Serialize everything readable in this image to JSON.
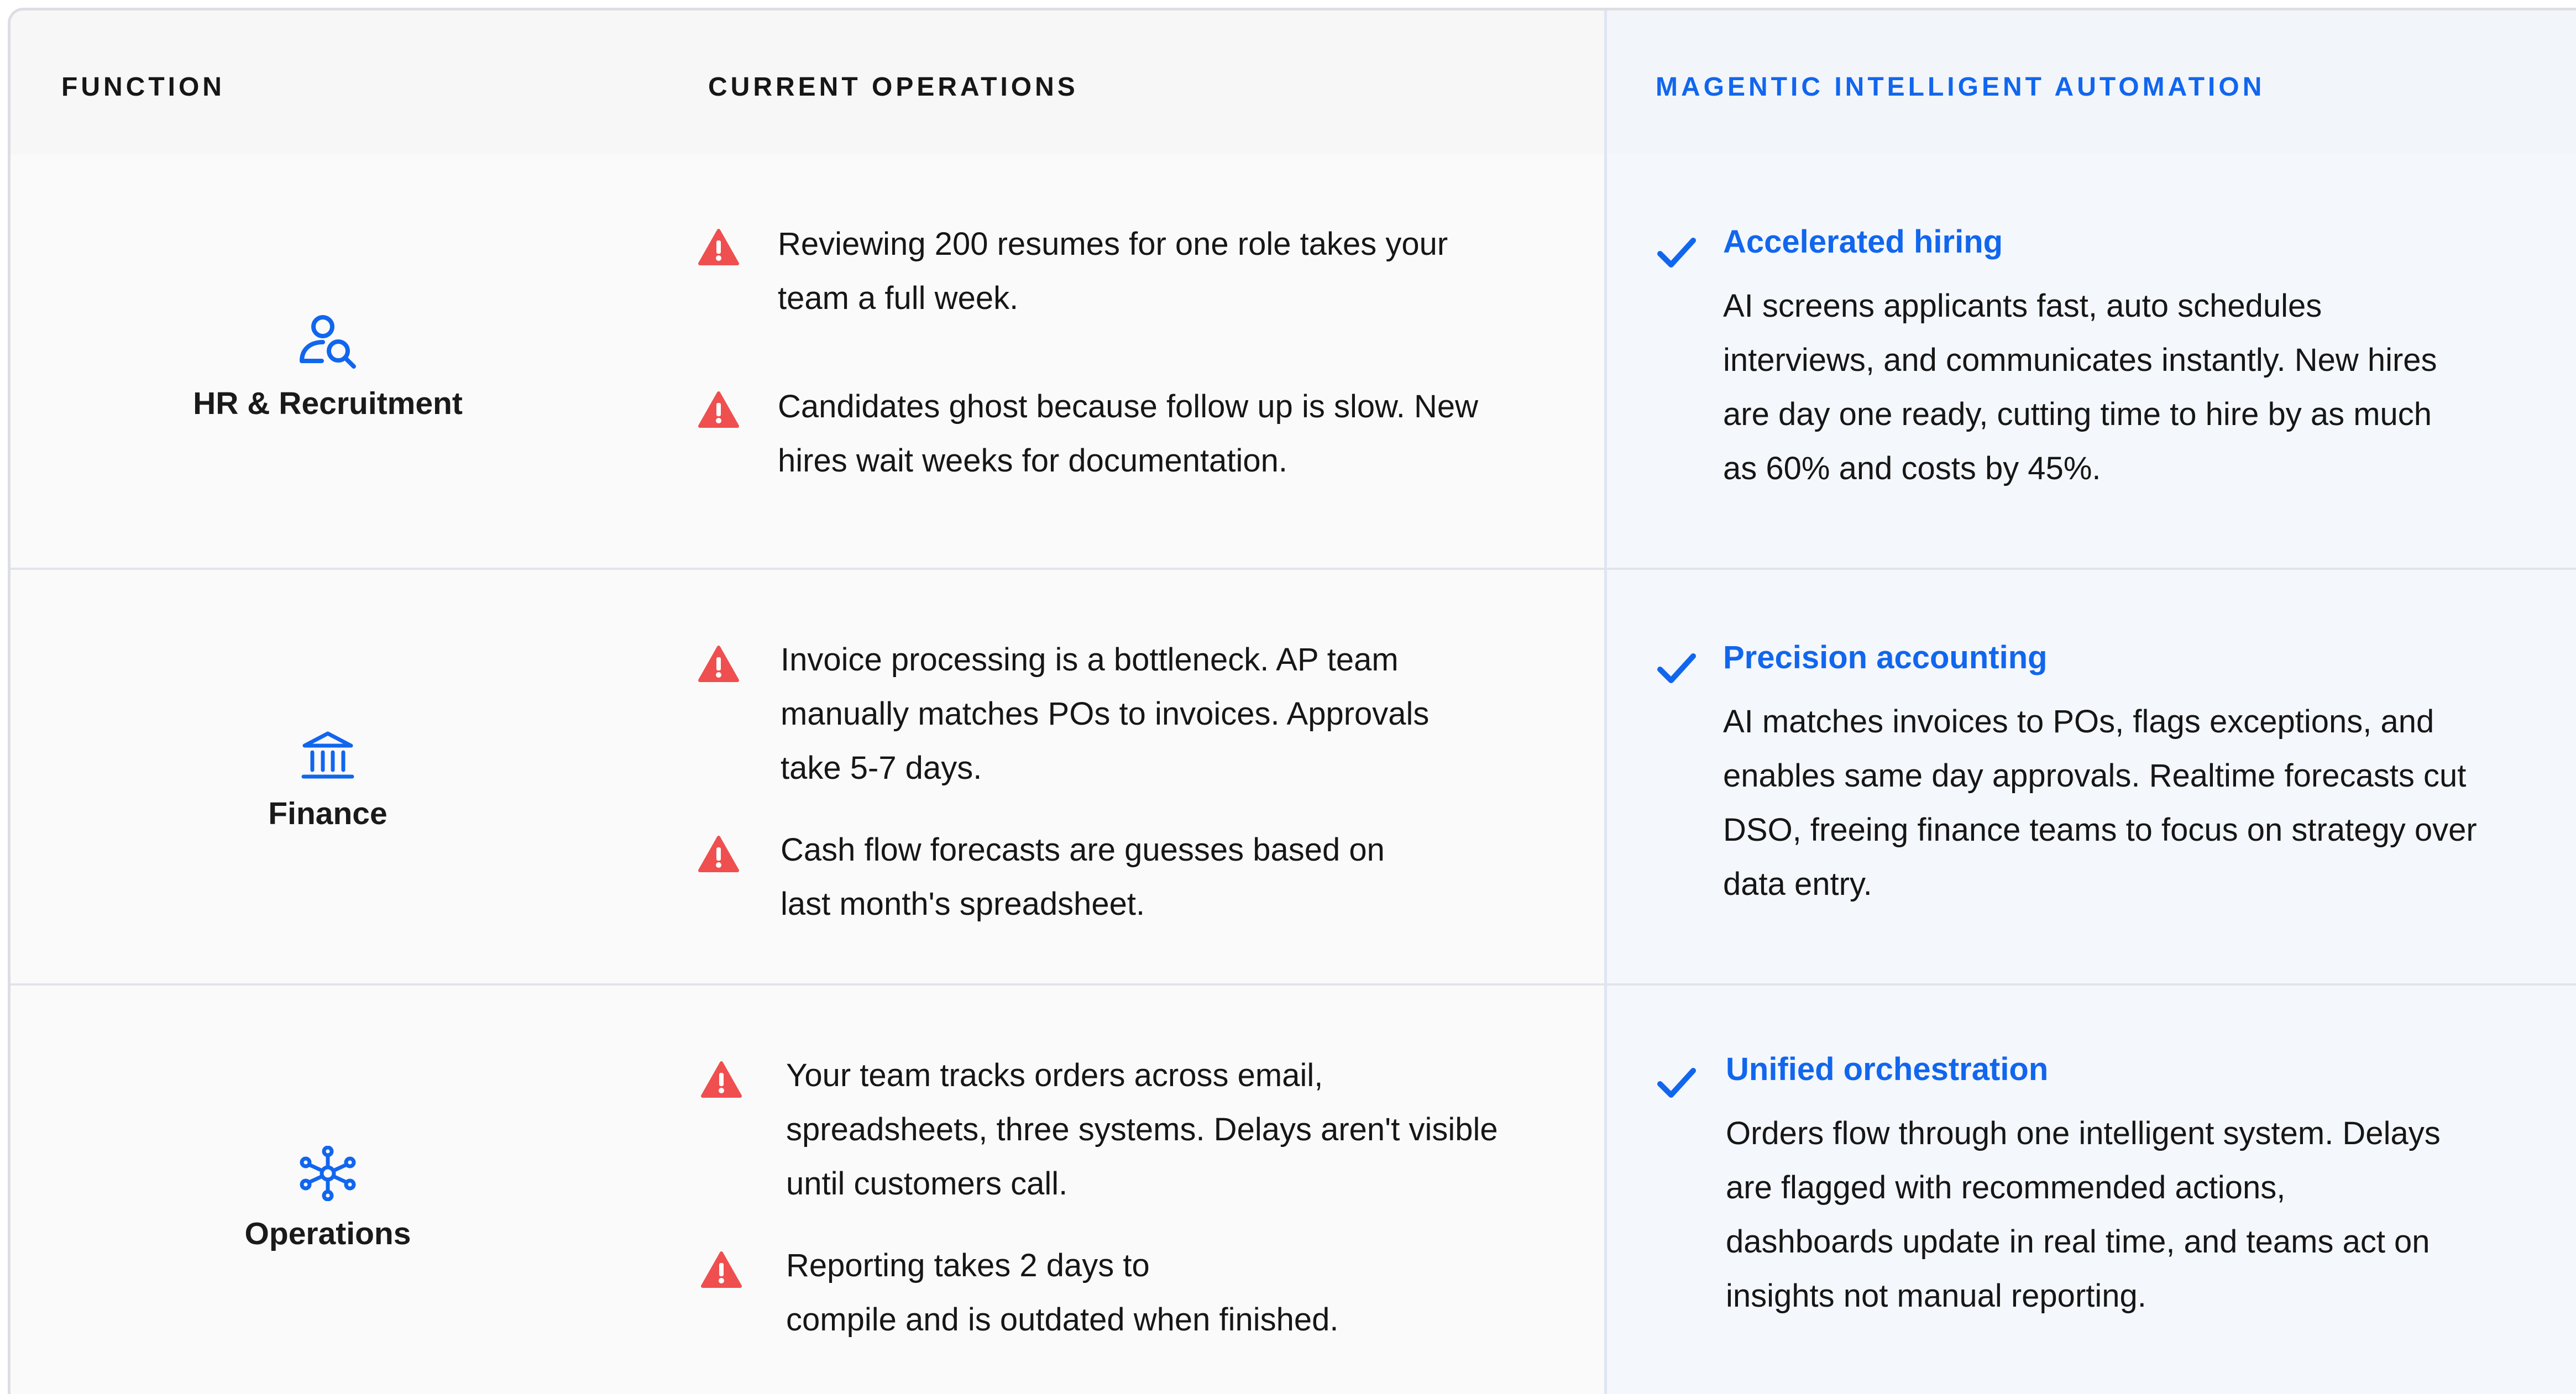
{
  "header": {
    "function": "FUNCTION",
    "current": "CURRENT OPERATIONS",
    "automation": "MAGENTIC INTELLIGENT AUTOMATION"
  },
  "colors": {
    "accent": "#1166ee",
    "warning": "#ef4f4f"
  },
  "rows": [
    {
      "function": "HR & Recruitment",
      "icon": "user-search-icon",
      "issues": [
        [
          "Reviewing 200 resumes for one role takes your",
          "team a full week."
        ],
        [
          "Candidates ghost because follow up is slow. New",
          "hires wait weeks for documentation."
        ]
      ],
      "solution_title": "Accelerated hiring",
      "solution_lines": [
        "AI screens applicants fast, auto schedules",
        "interviews, and communicates instantly. New hires",
        "are day one ready, cutting time to hire by as much",
        "as 60% and costs by 45%."
      ]
    },
    {
      "function": "Finance",
      "icon": "bank-icon",
      "issues": [
        [
          "Invoice processing is a bottleneck. AP team",
          "manually matches POs to invoices. Approvals",
          "take 5-7 days."
        ],
        [
          "Cash flow forecasts are guesses based on",
          "last month's spreadsheet."
        ]
      ],
      "solution_title": "Precision accounting",
      "solution_lines": [
        "AI matches invoices to POs, flags exceptions, and",
        "enables same day approvals. Realtime forecasts cut",
        "DSO, freeing finance teams to focus on strategy over",
        "data entry."
      ]
    },
    {
      "function": "Operations",
      "icon": "network-hub-icon",
      "issues": [
        [
          "Your team tracks orders across email,",
          "spreadsheets, three systems. Delays aren't visible",
          "until customers call."
        ],
        [
          "Reporting takes 2 days to",
          "compile and is outdated when finished."
        ]
      ],
      "solution_title": "Unified orchestration",
      "solution_lines": [
        "Orders flow through one intelligent system. Delays",
        "are flagged with recommended actions,",
        "dashboards update in real time, and teams act on",
        "insights not manual reporting."
      ]
    }
  ]
}
